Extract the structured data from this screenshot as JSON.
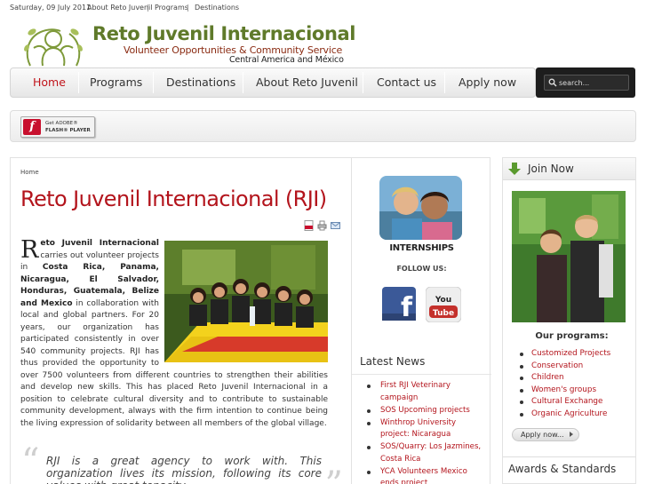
{
  "topbar": {
    "date": "Saturday, 09 July 2011",
    "links": [
      "About Reto Juvenil",
      "Programs",
      "Destinations"
    ],
    "separator": "|"
  },
  "brand": {
    "title": "Reto Juvenil Internacional",
    "subtitle": "Volunteer Opportunities & Community Service",
    "region": "Central America and México",
    "colors": {
      "title": "#5f7a2a",
      "subtitle": "#8a2b12"
    }
  },
  "nav": {
    "items": [
      "Home",
      "Programs",
      "Destinations",
      "About Reto Juvenil",
      "Contact us",
      "Apply now"
    ],
    "active_color": "#c0141b"
  },
  "search": {
    "placeholder": "search...",
    "icon": "search-icon"
  },
  "flash": {
    "line1": "Get ADOBE®",
    "line2": "FLASH® PLAYER",
    "icon": "flash-icon"
  },
  "main": {
    "breadcrumb": "Home",
    "title": "Reto Juvenil Internacional (RJI)",
    "tool_icons": [
      "pdf-icon",
      "print-icon",
      "email-icon"
    ],
    "article": {
      "dropcap": "R",
      "bold_org": "eto Juvenil Internacional",
      "p1": " carries out volunteer projects in ",
      "countries": "Costa Rica, Panama, Nicaragua, El Salvador, Honduras, Guatemala, Belize and Mexico",
      "p2": " in collaboration with local and global partners. For 20 years, our organization has participated consistently in over 540 community projects. RJI has thus provided the opportunity to over 7500 volunteers from different countries to strengthen their abilities and develop new skills. This has placed Reto Juvenil Internacional in a position to celebrate cultural diversity and to contribute to sustainable community development, always with the firm intention to continue being  the living expression of solidarity between all members of the global village."
    },
    "quote": "RJI is a great agency to work with. This organization lives its mission, following its core values with great tenacity"
  },
  "middle": {
    "internships_label": "INTERNSHIPS",
    "follow_label": "FOLLOW US:",
    "social_icons": [
      "facebook-icon",
      "youtube-icon"
    ],
    "youtube_text": "You Tube",
    "facebook_text": "f",
    "news_title": "Latest News",
    "news": [
      "First RJI Veterinary campaign",
      "SOS Upcoming projects",
      "Winthrop University project: Nicaragua",
      "SOS/Quarry: Los Jazmines, Costa Rica",
      "YCA Volunteers Mexico ends project"
    ]
  },
  "right": {
    "join_title": "Join Now",
    "join_icon": "download-arrow-icon",
    "programs_title": "Our programs:",
    "programs": [
      "Customized Projects",
      "Conservation",
      "Children",
      "Women's groups",
      "Cultural Exchange",
      "Organic Agriculture"
    ],
    "apply_label": "Apply now...",
    "awards_title": "Awards & Standards"
  },
  "colors": {
    "accent_red": "#b3141c",
    "search_bg": "#1d1d1d"
  }
}
